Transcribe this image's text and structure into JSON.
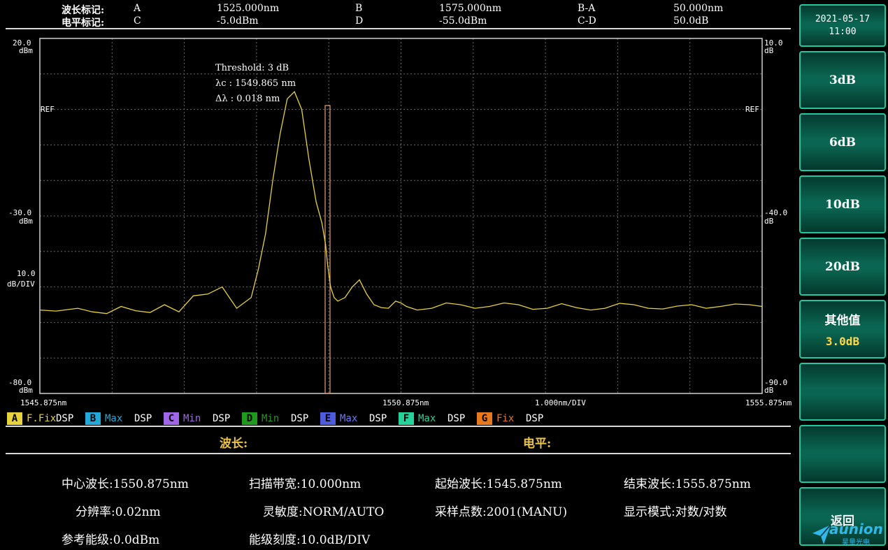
{
  "markers": {
    "row1": {
      "label": "波长标记:",
      "a_key": "A",
      "a_val": "1525.000nm",
      "b_key": "B",
      "b_val": "1575.000nm",
      "diff_key": "B-A",
      "diff_val": "50.000nm"
    },
    "row2": {
      "label": "电平标记:",
      "a_key": "C",
      "a_val": "-5.0dBm",
      "b_key": "D",
      "b_val": "-55.0dBm",
      "diff_key": "C-D",
      "diff_val": "50.0dB"
    }
  },
  "chart_data": {
    "type": "line",
    "title": "",
    "xlabel": "",
    "ylabel": "",
    "xlim": [
      1545.875,
      1555.875
    ],
    "ylim": [
      -80.0,
      20.0
    ],
    "y_left_ticks": [
      {
        "value": "20.0",
        "unit": "dBm"
      },
      {
        "value": "-30.0",
        "unit": "dBm"
      },
      {
        "value": "-80.0",
        "unit": "dBm"
      }
    ],
    "y_right_ticks": [
      {
        "value": "10.0",
        "unit": "dB"
      },
      {
        "value": "-40.0",
        "unit": "dB"
      },
      {
        "value": "-90.0",
        "unit": "dB"
      }
    ],
    "scale_label": {
      "value": "10.0",
      "unit": "dB/DIV"
    },
    "ref_label": "REF",
    "x_ticks": {
      "start": "1545.875nm",
      "center": "1550.875nm",
      "span": "1.000nm/DIV",
      "stop": "1555.875nm"
    },
    "annotations": [
      "Threshold: 3 dB",
      "λc   : 1549.865 nm",
      "Δλ  : 0.018 nm"
    ],
    "grid": true,
    "series": [
      {
        "color": "#e6d23a",
        "x": [
          1545.875,
          1546.1,
          1546.4,
          1546.6,
          1546.8,
          1547.0,
          1547.2,
          1547.4,
          1547.6,
          1547.8,
          1548.0,
          1548.2,
          1548.4,
          1548.6,
          1548.8,
          1548.9,
          1549.0,
          1549.1,
          1549.2,
          1549.3,
          1549.4,
          1549.5,
          1549.6,
          1549.7,
          1549.78,
          1549.83,
          1549.86,
          1549.9,
          1549.95,
          1550.0,
          1550.1,
          1550.2,
          1550.3,
          1550.4,
          1550.5,
          1550.6,
          1550.7,
          1550.8,
          1550.875,
          1550.95,
          1551.1,
          1551.3,
          1551.5,
          1551.7,
          1551.9,
          1552.1,
          1552.3,
          1552.5,
          1552.7,
          1552.9,
          1553.1,
          1553.3,
          1553.5,
          1553.7,
          1553.9,
          1554.1,
          1554.3,
          1554.5,
          1554.7,
          1554.9,
          1555.1,
          1555.3,
          1555.5,
          1555.7,
          1555.875
        ],
        "y": [
          -56.5,
          -56.8,
          -56.0,
          -57.0,
          -57.5,
          -55.5,
          -56.7,
          -57.2,
          -55.0,
          -57.0,
          -52.5,
          -52.0,
          -50.0,
          -56.0,
          -53.0,
          -45.0,
          -35.0,
          -20.0,
          -7.0,
          3.0,
          5.0,
          0.0,
          -14.0,
          -26.0,
          -32.0,
          -38.0,
          -44.0,
          -50.0,
          -53.0,
          -54.0,
          -53.0,
          -50.0,
          -48.0,
          -52.0,
          -55.0,
          -55.8,
          -56.0,
          -54.0,
          -54.5,
          -55.5,
          -56.5,
          -56.0,
          -54.5,
          -55.0,
          -56.0,
          -55.5,
          -54.5,
          -55.0,
          -56.3,
          -56.0,
          -54.7,
          -55.8,
          -56.5,
          -56.0,
          -54.6,
          -55.0,
          -56.0,
          -56.2,
          -55.4,
          -55.0,
          -56.0,
          -55.5,
          -54.8,
          -55.0,
          -55.5
        ]
      }
    ]
  },
  "traces": [
    {
      "key": "A",
      "mode": "F.Fix",
      "dsp": "DSP",
      "color": "#e6d23a",
      "text_color": "#e6d23a"
    },
    {
      "key": "B",
      "mode": "Max",
      "dsp": "DSP",
      "color": "#23a9d9",
      "text_color": "#23a9d9"
    },
    {
      "key": "C",
      "mode": "Min",
      "dsp": "DSP",
      "color": "#a066e8",
      "text_color": "#a066e8"
    },
    {
      "key": "D",
      "mode": "Min",
      "dsp": "DSP",
      "color": "#1f9a1f",
      "text_color": "#1f9a1f"
    },
    {
      "key": "E",
      "mode": "Max",
      "dsp": "DSP",
      "color": "#4d5bdf",
      "text_color": "#6b78ff"
    },
    {
      "key": "F",
      "mode": "Max",
      "dsp": "DSP",
      "color": "#25d39a",
      "text_color": "#25d39a"
    },
    {
      "key": "G",
      "mode": "Fix",
      "dsp": "DSP",
      "color": "#e8781e",
      "text_color": "#e8781e"
    }
  ],
  "readout": {
    "wavelength_label": "波长:",
    "level_label": "电平:"
  },
  "params": {
    "center_wl": "中心波长:1550.875nm",
    "span": "扫描带宽:10.000nm",
    "start_wl": "起始波长:1545.875nm",
    "stop_wl": "结束波长:1555.875nm",
    "resolution": "分辨率:0.02nm",
    "sensitivity": "灵敏度:NORM/AUTO",
    "points": "采样点数:2001(MANU)",
    "display_mode": "显示模式:对数/对数",
    "ref_level": "参考能级:0.0dBm",
    "scale": "能级刻度:10.0dB/DIV"
  },
  "side": {
    "date": "2021-05-17",
    "time": "11:00",
    "btn_3db": "3dB",
    "btn_6db": "6dB",
    "btn_10db": "10dB",
    "btn_20db": "20dB",
    "btn_other": "其他值",
    "btn_other_value": "3.0dB",
    "btn_back": "返回",
    "logo_word": "aunion",
    "logo_cn": "昊量光电"
  }
}
